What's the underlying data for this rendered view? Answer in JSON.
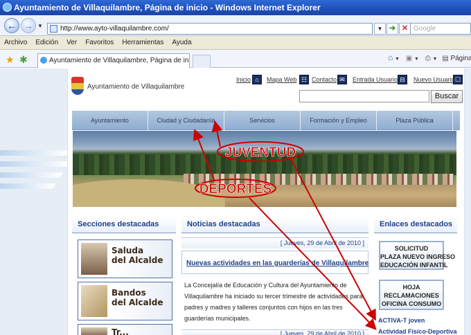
{
  "window": {
    "title": "Ayuntamiento de Villaquilambre, Página de inicio - Windows Internet Explorer"
  },
  "address": {
    "url": "http://www.ayto-villaquilambre.com/",
    "search_placeholder": "Google"
  },
  "menubar": [
    "Archivo",
    "Edición",
    "Ver",
    "Favoritos",
    "Herramientas",
    "Ayuda"
  ],
  "tab": {
    "title": "Ayuntamiento de Villaquilambre, Página de inicio"
  },
  "toolbar": {
    "page_label": "Página"
  },
  "site": {
    "name": "Ayuntamiento de Villaquilambre",
    "toplinks": [
      "Inicio",
      "Mapa Web",
      "Contacto",
      "Entrada Usuarios",
      "Nuevo Usuario"
    ],
    "search_button": "Buscar",
    "nav": [
      "Ayuntamiento",
      "Ciudad y Ciudadanía",
      "Servicios",
      "Formación y Empleo",
      "Plaza Pública"
    ]
  },
  "annotations": {
    "label1": "JUVENTUD",
    "label2": "DEPORTES",
    "color": "#cc0000"
  },
  "sections": {
    "left_title": "Secciones destacadas",
    "center_title": "Noticias destacadas",
    "right_title": "Enlaces destacados"
  },
  "left_boxes": [
    "Saluda\ndel Alcalde",
    "Bandos\ndel Alcalde",
    "Tr..."
  ],
  "news": {
    "date1": "[ Jueves, 29 de Abril de 2010 ]",
    "title1": "Nuevas actividades en las guarderías de Villaquilambre",
    "text1": "La Concejalía de Educación y Cultura del Ayuntamiento de Villaquilambre ha iniciado su tercer trimestre de actividades para padres y madres y talleres conjuntos con hijos en las tres guarderías municipales.",
    "date2": "[ Jueves, 29 de Abril de 2010 ]"
  },
  "right": {
    "btn1": "SOLICITUD\nPLAZA NUEVO INGRESO\nEDUCACIÓN INFANTIL",
    "btn2": "HOJA\nRECLAMACIONES\nOFICINA CONSUMO",
    "link1": "ACTIVA-T joven",
    "link2": "Actividad Físico-Deportiva"
  }
}
